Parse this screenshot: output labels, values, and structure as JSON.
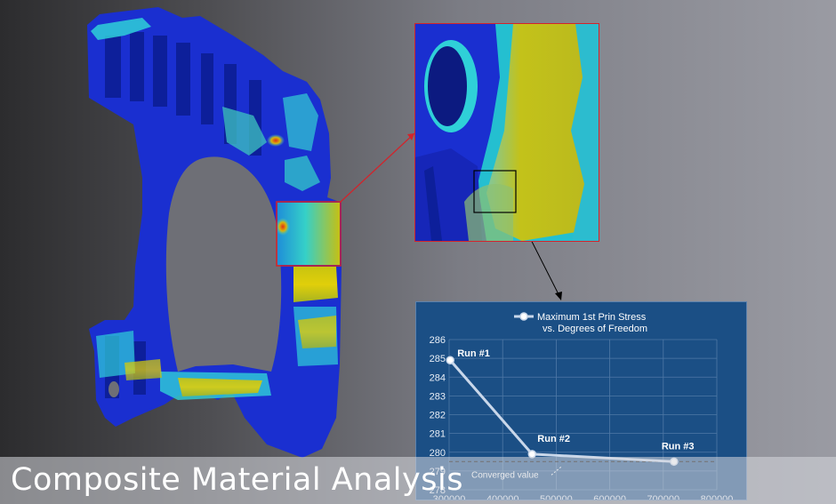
{
  "caption": "Composite Material Analysis",
  "colors": {
    "mesh_blue": "#1a2fd0",
    "stress_cyan": "#2fd0d8",
    "stress_yellow": "#c9c412",
    "highlight_box": "#d3232b",
    "chart_bg": "#1b4f85"
  },
  "chart_data": {
    "type": "line",
    "title_line1": "Maximum 1st Prin Stress",
    "title_line2": "vs. Degrees of Freedom",
    "legend_position": "top",
    "grid": true,
    "xlim": [
      300000,
      800000
    ],
    "ylim": [
      278,
      286
    ],
    "x_ticks": [
      "300000",
      "400000",
      "500000",
      "600000",
      "700000",
      "800000"
    ],
    "y_ticks": [
      "278",
      "279",
      "280",
      "281",
      "282",
      "283",
      "284",
      "285",
      "286"
    ],
    "series": [
      {
        "name": "Maximum 1st Prin Stress",
        "x": [
          302000,
          455000,
          720000
        ],
        "y": [
          284.9,
          279.9,
          279.5
        ],
        "labels": [
          "Run #1",
          "Run #2",
          "Run #3"
        ]
      }
    ],
    "reference_line": {
      "y": 279.5,
      "label": "Converged value"
    }
  }
}
